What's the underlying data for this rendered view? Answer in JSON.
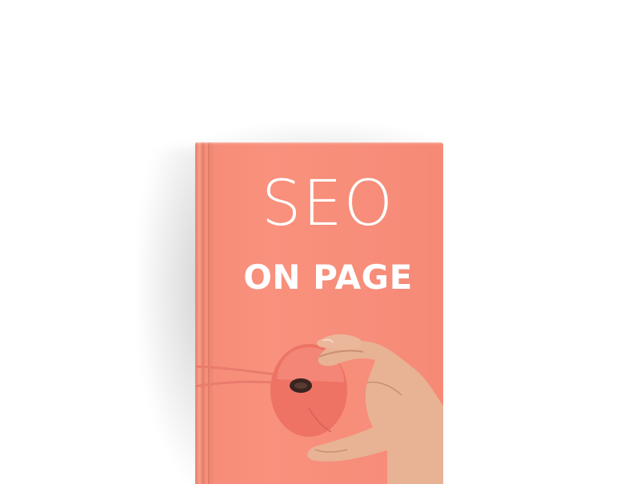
{
  "book": {
    "title_line1": "SEO",
    "title_line2": "ON PAGE"
  },
  "colors": {
    "cover": "#f68c78",
    "mouse": "#ef6f62",
    "skin": "#e8b294",
    "background": "#ffffff"
  },
  "icons": {
    "mouse": "computer-mouse-icon",
    "hand": "hand-icon"
  }
}
